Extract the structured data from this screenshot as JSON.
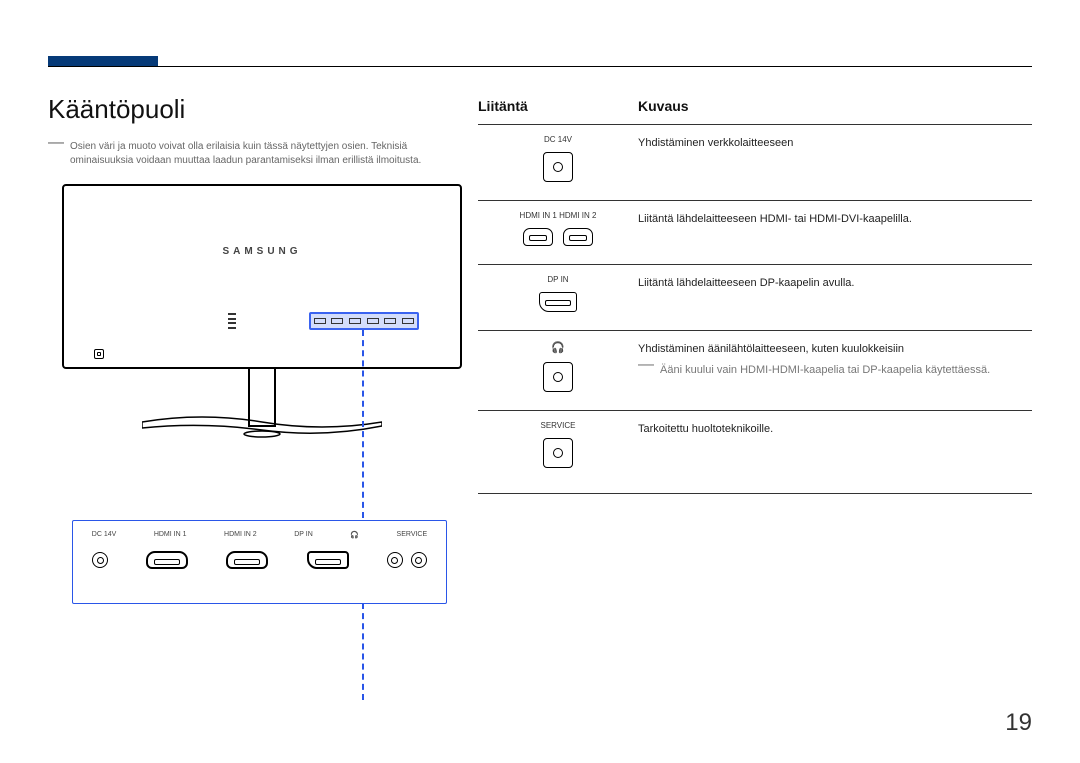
{
  "page_number": "19",
  "heading": "Kääntöpuoli",
  "note_dash": "―",
  "note_text": "Osien väri ja muoto voivat olla erilaisia kuin tässä näytettyjen osien. Teknisiä ominaisuuksia voidaan muuttaa laadun parantamiseksi ilman erillistä ilmoitusta.",
  "brand": "SAMSUNG",
  "panel_labels": {
    "dc": "DC 14V",
    "hdmi1": "HDMI IN 1",
    "hdmi2": "HDMI IN 2",
    "dp": "DP IN",
    "hp_icon": "🎧",
    "service": "SERVICE"
  },
  "table": {
    "col1": "Liitäntä",
    "col2": "Kuvaus",
    "rows": [
      {
        "label": "DC 14V",
        "desc": "Yhdistäminen verkkolaitteeseen",
        "sub": ""
      },
      {
        "label": "HDMI IN 1   HDMI IN 2",
        "desc": "Liitäntä lähdelaitteeseen HDMI- tai HDMI-DVI-kaapelilla.",
        "sub": ""
      },
      {
        "label": "DP IN",
        "desc": "Liitäntä lähdelaitteeseen DP-kaapelin avulla.",
        "sub": ""
      },
      {
        "label": "🎧",
        "desc": "Yhdistäminen äänilähtölaitteeseen, kuten kuulokkeisiin",
        "sub": "Ääni kuului vain HDMI-HDMI-kaapelia tai DP-kaapelia käytettäessä."
      },
      {
        "label": "SERVICE",
        "desc": "Tarkoitettu huoltoteknikoille.",
        "sub": ""
      }
    ]
  }
}
